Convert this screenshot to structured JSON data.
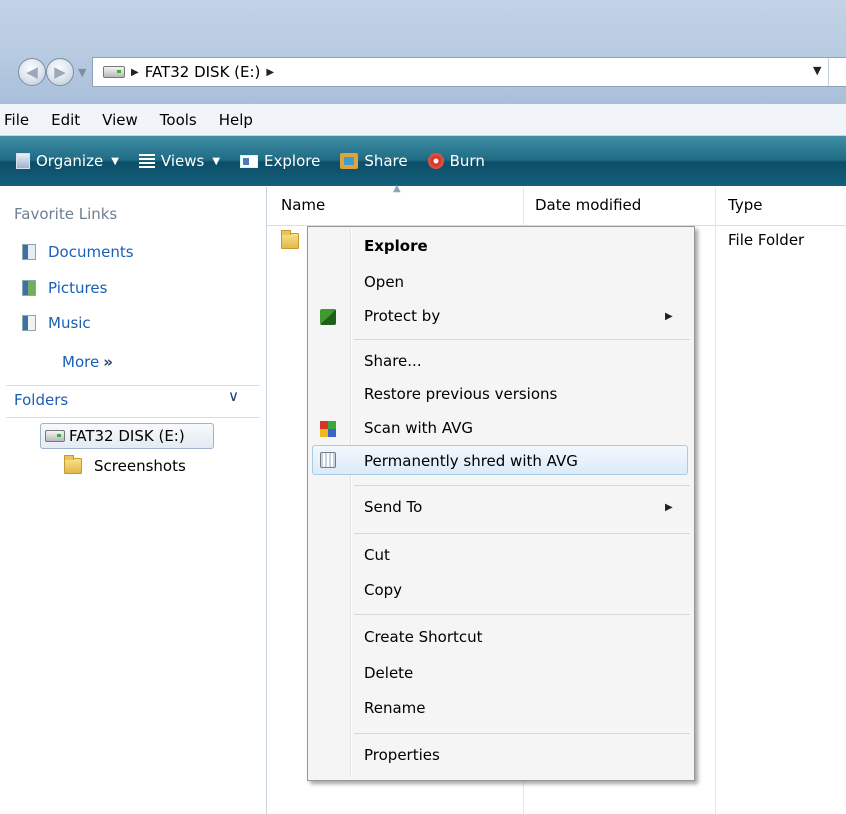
{
  "window": {
    "address": {
      "drive_label": "FAT32 DISK (E:)"
    }
  },
  "menubar": {
    "items": [
      "File",
      "Edit",
      "View",
      "Tools",
      "Help"
    ]
  },
  "toolbar": {
    "organize": "Organize",
    "views": "Views",
    "explore": "Explore",
    "share": "Share",
    "burn": "Burn"
  },
  "sidebar": {
    "favorites_heading": "Favorite Links",
    "links": [
      "Documents",
      "Pictures",
      "Music"
    ],
    "more": "More",
    "folders_heading": "Folders",
    "tree_drive": "FAT32 DISK (E:)",
    "tree_folder": "Screenshots"
  },
  "filelist": {
    "columns": [
      "Name",
      "Date modified",
      "Type"
    ],
    "row_type": "File Folder"
  },
  "context_menu": {
    "items": [
      "Explore",
      "Open",
      "Protect by",
      "Share...",
      "Restore previous versions",
      "Scan with AVG",
      "Permanently shred with AVG",
      "Send To",
      "Cut",
      "Copy",
      "Create Shortcut",
      "Delete",
      "Rename",
      "Properties"
    ],
    "highlighted": "Permanently shred with AVG"
  }
}
